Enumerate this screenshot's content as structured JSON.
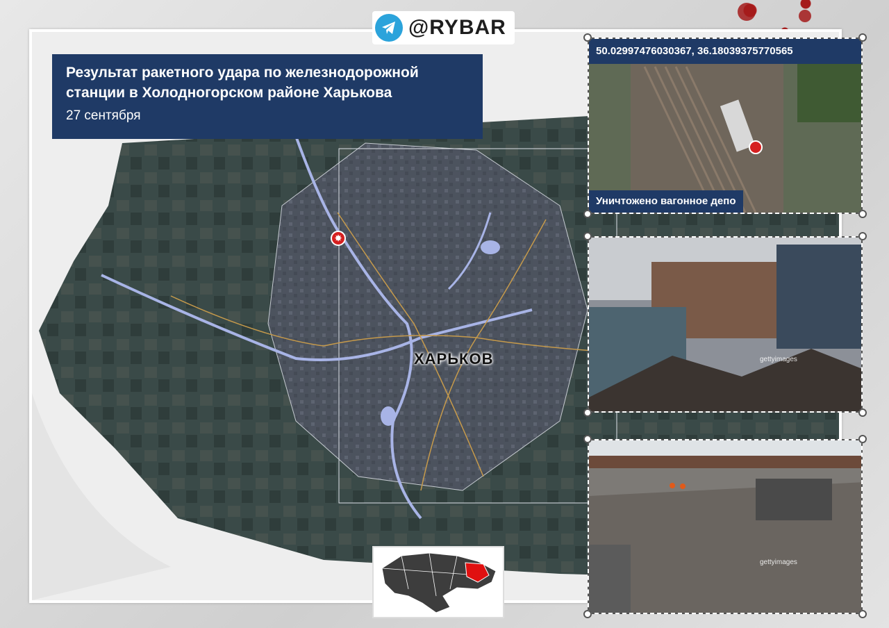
{
  "header": {
    "brand": "@RYBAR"
  },
  "title": {
    "text": "Результат ракетного удара по железнодорожной станции в Холодногорском районе Харькова",
    "date": "27 сентября"
  },
  "map": {
    "city_label": "ХАРЬКОВ",
    "strike_icon": "explosion-marker-icon"
  },
  "photos": [
    {
      "coords": "50.02997476030367, 36.18039375770565",
      "caption": "Уничтожено вагонное депо"
    },
    {
      "credit": "gettyimages"
    },
    {
      "credit": "gettyimages"
    }
  ],
  "colors": {
    "accent_blue": "#1f3a66",
    "strike_red": "#d62020",
    "region_red": "#e01010"
  }
}
